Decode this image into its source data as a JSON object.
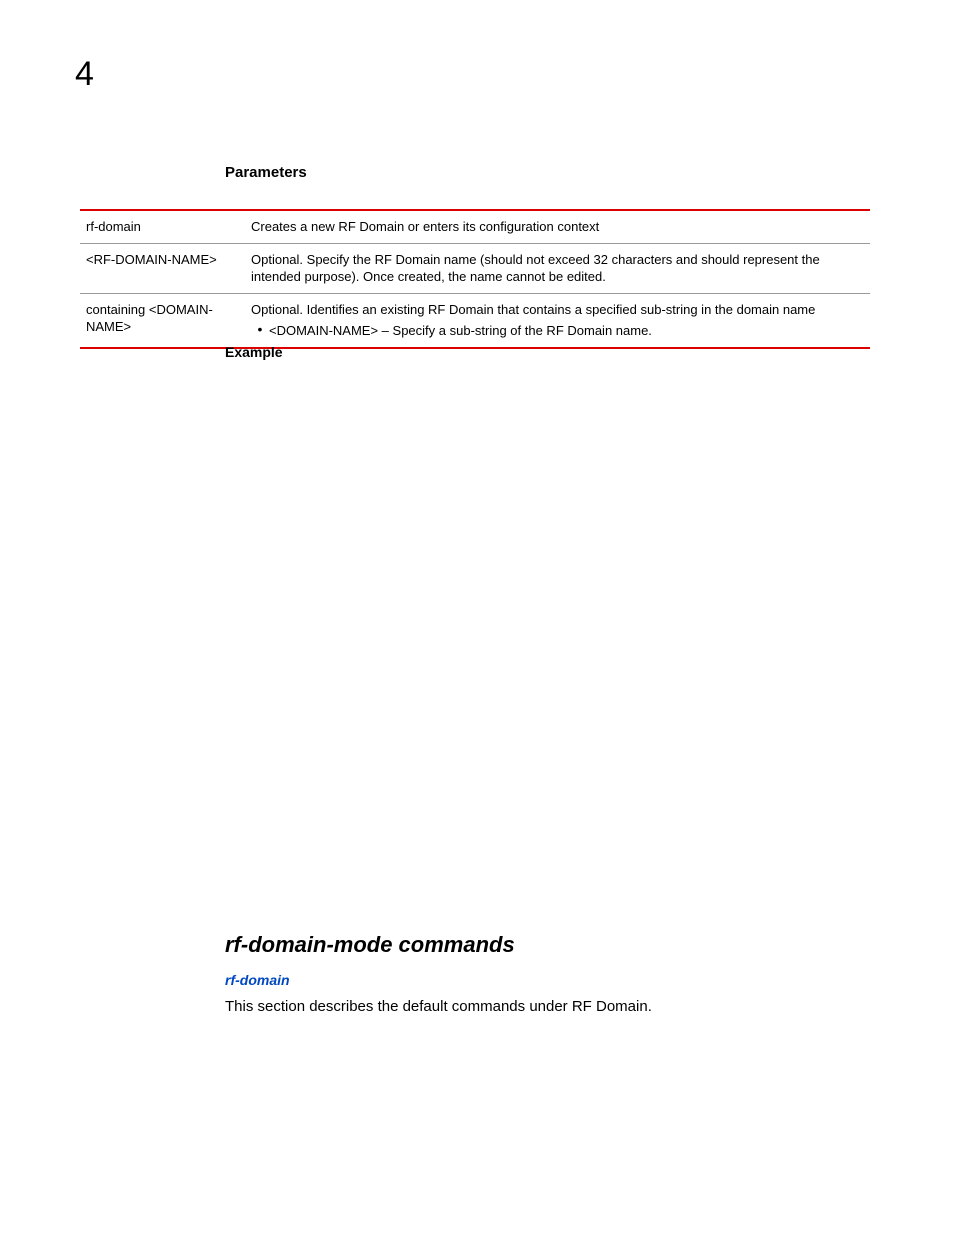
{
  "chapterNumber": "4",
  "parametersHeading": "Parameters",
  "table": {
    "rows": [
      {
        "param": "rf-domain",
        "desc": "Creates a new RF Domain or enters its configuration context"
      },
      {
        "param": "<RF-DOMAIN-NAME>",
        "desc": "Optional. Specify the RF Domain name (should not exceed 32 characters and should represent the intended purpose). Once created, the name cannot be edited."
      },
      {
        "param": "containing <DOMAIN-NAME>",
        "desc": "Optional. Identifies an existing RF Domain that contains a specified sub-string in the domain name",
        "bullet": "<DOMAIN-NAME> – Specify a sub-string of the RF Domain name."
      }
    ]
  },
  "exampleHeading": "Example",
  "section2": {
    "title": "rf-domain-mode commands",
    "link": "rf-domain",
    "body": "This section describes the default commands under RF Domain."
  }
}
